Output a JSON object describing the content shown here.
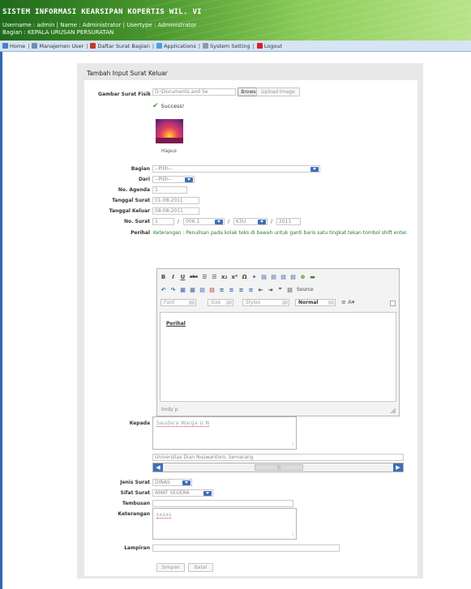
{
  "header": {
    "title": "SISTEM INFORMASI KEARSIPAN KOPERTIS WIL. VI",
    "userline": "Username : admin | Name : Administrator | Usertype : Administrator",
    "bagian": "Bagian : KEPALA URUSAN PERSURATAN"
  },
  "nav": {
    "items": [
      {
        "label": "Home",
        "icon": "house-icon"
      },
      {
        "label": "Manajemen User",
        "icon": "users-icon"
      },
      {
        "label": "Daftar Surat Bagian",
        "icon": "mail-icon"
      },
      {
        "label": "Applications",
        "icon": "apps-icon"
      },
      {
        "label": "System Setting",
        "icon": "settings-icon"
      },
      {
        "label": "Logout",
        "icon": "logout-icon"
      }
    ],
    "separator": "|"
  },
  "form": {
    "title": "Tambah Input Surat Keluar",
    "gambar_label": "Gambar Surat Fisik",
    "file_value": "D:\\Documents and Se",
    "browse_label": "Browse...",
    "upload_label": "Upload Image",
    "success_text": "Success!",
    "hapus_label": "Hapus",
    "bagian_label": "Bagian",
    "bagian_value": "--Pilih--",
    "dari_label": "Dari",
    "dari_value": "--Pilih--",
    "agenda_label": "No. Agenda",
    "agenda_value": "1",
    "tgl_surat_label": "Tanggal Surat",
    "tgl_surat_value": "01-08-2011",
    "tgl_keluar_label": "Tanggal Keluar",
    "tgl_keluar_value": "08-08-2011",
    "nosurat_label": "No. Surat",
    "nosurat_1": "1",
    "nosurat_sep": "/",
    "nosurat_2": "006.1",
    "nosurat_3": "K3U",
    "nosurat_4": "2011",
    "perihal_label": "Perihal",
    "perihal_note": "Keterangan : Penulisan pada kolak teks di bawah untuk ganti baris satu tingkat tekan tombol shift enter.",
    "kepada_label": "Kepada",
    "kepada_value": "Saudara Warga U.N",
    "universitas_value": "Universitas Dian Nuswantoro, Semarang",
    "jenis_label": "Jenis Surat",
    "jenis_value": "DINAS",
    "sifat_label": "Sifat Surat",
    "sifat_value": "AMAT SEGERA",
    "tembusan_label": "Tembusan",
    "keterangan_label": "Keterangan",
    "keterangan_value": "sxsxs",
    "lampiran_label": "Lampiran",
    "simpan_label": "Simpan",
    "batal_label": "Batal"
  },
  "editor": {
    "row1": [
      "B",
      "I",
      "U",
      "abc",
      "☰",
      "☰",
      "x₂",
      "x²",
      "Ω",
      "✦",
      "▤",
      "▤",
      "▤",
      "▤",
      "⊕",
      "▬"
    ],
    "row2": [
      "↶",
      "↷",
      "▦",
      "▦",
      "▤",
      "▤",
      "≡",
      "≡",
      "≡",
      "≡",
      "⇤",
      "⇥",
      "❞",
      "▤",
      "Source"
    ],
    "font_label": "Font",
    "size_label": "Size",
    "styles_label": "Styles",
    "format_label": "Normal",
    "content": "Perihal",
    "status": "body p"
  },
  "colors": {
    "header_green": "#3f8a2a",
    "nav_bg": "#d6e4f5",
    "accent_blue": "#3e6fb8",
    "note_green": "#2b7a2b"
  }
}
